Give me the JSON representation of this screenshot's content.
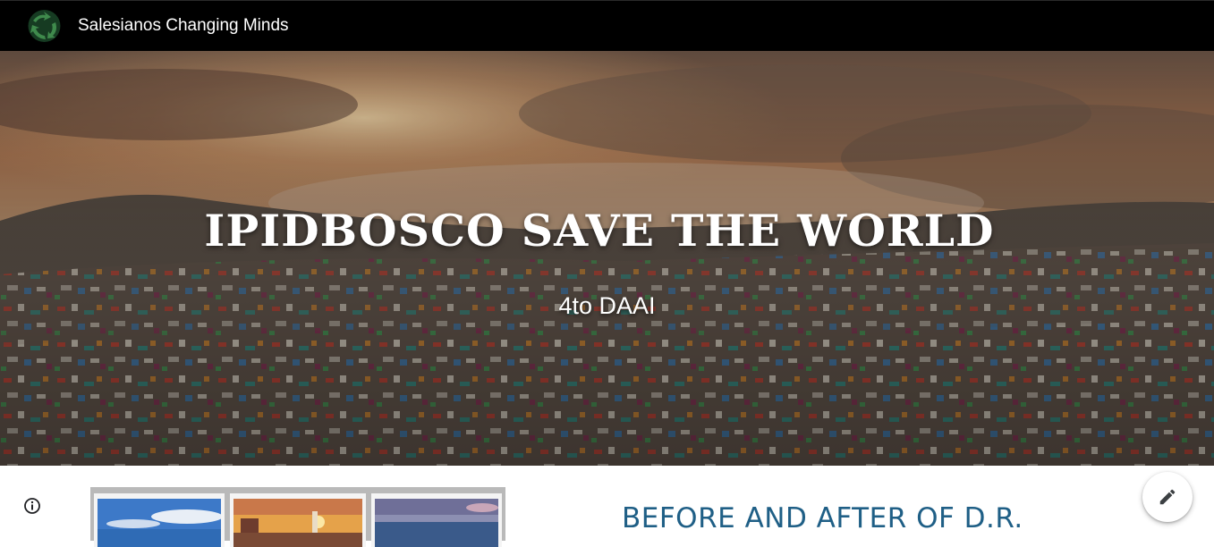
{
  "header": {
    "site_title": "Salesianos Changing Minds",
    "logo_icon": "recycle-globe-icon"
  },
  "hero": {
    "title": "IPIDBOSCO SAVE THE WORLD",
    "subtitle": "4to DAAI"
  },
  "content": {
    "section_heading": "BEFORE AND AFTER OF D.R."
  },
  "controls": {
    "info_icon": "info-icon",
    "edit_icon": "pencil-icon"
  },
  "colors": {
    "topbar": "#000000",
    "heading": "#1f5f86",
    "logo_green": "#2f6b3a"
  }
}
